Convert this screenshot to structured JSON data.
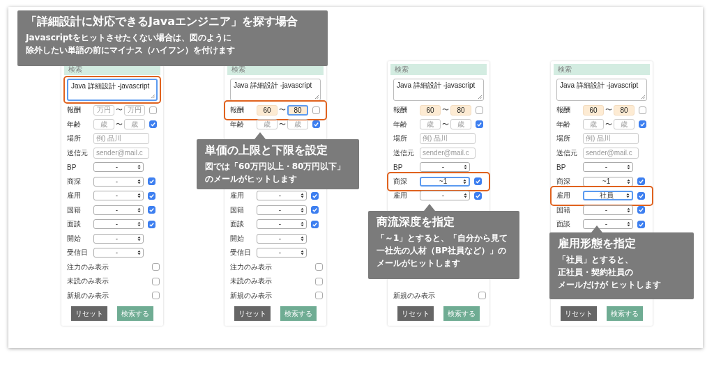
{
  "panels": [
    {
      "header": "検索",
      "query": {
        "value": "Java 詳細設計 -javascript",
        "focused": true,
        "highlighted": true
      },
      "rows": [
        {
          "kind": "range",
          "label": "報酬",
          "min": {
            "placeholder": "万円",
            "focused": false
          },
          "separator": "〜",
          "max": {
            "placeholder": "万円",
            "focused": false
          },
          "checked": false
        },
        {
          "kind": "range",
          "label": "年齢",
          "min": {
            "placeholder": "歳",
            "focused": false
          },
          "separator": "〜",
          "max": {
            "placeholder": "歳",
            "focused": false
          },
          "checked": true
        },
        {
          "kind": "text",
          "label": "場所",
          "placeholder": "例) 品川"
        },
        {
          "kind": "text",
          "label": "送信元",
          "placeholder": "sender@mail.c"
        },
        {
          "kind": "select",
          "label": "BP",
          "value": "-",
          "focused": false
        },
        {
          "kind": "select",
          "label": "商深",
          "value": "-",
          "focused": false,
          "checked": true
        },
        {
          "kind": "select",
          "label": "雇用",
          "value": "-",
          "focused": false,
          "checked": true
        },
        {
          "kind": "select",
          "label": "国籍",
          "value": "-",
          "focused": false,
          "checked": true
        },
        {
          "kind": "select",
          "label": "面談",
          "value": "-",
          "focused": false,
          "checked": true
        },
        {
          "kind": "select",
          "label": "開始",
          "value": "-",
          "focused": false
        },
        {
          "kind": "select",
          "label": "受信日",
          "value": "-",
          "focused": false
        },
        {
          "kind": "toggle",
          "label": "注力のみ表示",
          "checked": false
        },
        {
          "kind": "toggle",
          "label": "未読のみ表示",
          "checked": false
        },
        {
          "kind": "toggle",
          "label": "新規のみ表示",
          "checked": false
        }
      ],
      "buttons": [
        {
          "kind": "reset",
          "label": "リセット"
        },
        {
          "kind": "submit",
          "label": "検索する"
        }
      ]
    },
    {
      "header": "検索",
      "query": {
        "value": "Java 詳細設計 -javascript",
        "focused": false
      },
      "rows": [
        {
          "kind": "range",
          "label": "報酬",
          "min": {
            "value": "60",
            "focused": false
          },
          "separator": "〜",
          "max": {
            "value": "80",
            "focused": true
          },
          "checked": false,
          "highlighted": true
        },
        {
          "kind": "range",
          "label": "年齢",
          "min": {
            "placeholder": "歳",
            "focused": false
          },
          "separator": "〜",
          "max": {
            "placeholder": "歳",
            "focused": false
          },
          "checked": true
        },
        {
          "kind": "covered"
        },
        {
          "kind": "covered"
        },
        {
          "kind": "covered"
        },
        {
          "kind": "covered"
        },
        {
          "kind": "select",
          "label": "雇用",
          "value": "-",
          "focused": false,
          "checked": true
        },
        {
          "kind": "select",
          "label": "国籍",
          "value": "-",
          "focused": false,
          "checked": true
        },
        {
          "kind": "select",
          "label": "面談",
          "value": "-",
          "focused": false,
          "checked": true
        },
        {
          "kind": "select",
          "label": "開始",
          "value": "-",
          "focused": false
        },
        {
          "kind": "select",
          "label": "受信日",
          "value": "-",
          "focused": false
        },
        {
          "kind": "toggle",
          "label": "注力のみ表示",
          "checked": false
        },
        {
          "kind": "toggle",
          "label": "未読のみ表示",
          "checked": false
        },
        {
          "kind": "toggle",
          "label": "新規のみ表示",
          "checked": false
        }
      ],
      "buttons": [
        {
          "kind": "reset",
          "label": "リセット"
        },
        {
          "kind": "submit",
          "label": "検索する"
        }
      ]
    },
    {
      "header": "検索",
      "query": {
        "value": "Java 詳細設計 -javascript",
        "focused": false
      },
      "rows": [
        {
          "kind": "range",
          "label": "報酬",
          "min": {
            "value": "60",
            "focused": false
          },
          "separator": "〜",
          "max": {
            "value": "80",
            "focused": false
          },
          "checked": false
        },
        {
          "kind": "range",
          "label": "年齢",
          "min": {
            "placeholder": "歳",
            "focused": false
          },
          "separator": "〜",
          "max": {
            "placeholder": "歳",
            "focused": false
          },
          "checked": true
        },
        {
          "kind": "text",
          "label": "場所",
          "placeholder": "例) 品川"
        },
        {
          "kind": "text",
          "label": "送信元",
          "placeholder": "sender@mail.c"
        },
        {
          "kind": "select",
          "label": "BP",
          "value": "-",
          "focused": false
        },
        {
          "kind": "select",
          "label": "商深",
          "value": "~1",
          "focused": true,
          "highlighted": true,
          "checked": true
        },
        {
          "kind": "select",
          "label": "雇用",
          "value": "-",
          "focused": false,
          "checked": true
        },
        {
          "kind": "covered"
        },
        {
          "kind": "covered"
        },
        {
          "kind": "covered"
        },
        {
          "kind": "covered"
        },
        {
          "kind": "covered"
        },
        {
          "kind": "covered"
        },
        {
          "kind": "toggle",
          "label": "新規のみ表示",
          "checked": false
        }
      ],
      "buttons": [
        {
          "kind": "reset",
          "label": "リセット"
        },
        {
          "kind": "submit",
          "label": "検索する"
        }
      ]
    },
    {
      "header": "検索",
      "query": {
        "value": "Java 詳細設計 -javascript",
        "focused": false
      },
      "rows": [
        {
          "kind": "range",
          "label": "報酬",
          "min": {
            "value": "60",
            "focused": false
          },
          "separator": "〜",
          "max": {
            "value": "80",
            "focused": false
          },
          "checked": false
        },
        {
          "kind": "range",
          "label": "年齢",
          "min": {
            "placeholder": "歳",
            "focused": false
          },
          "separator": "〜",
          "max": {
            "placeholder": "歳",
            "focused": false
          },
          "checked": true
        },
        {
          "kind": "text",
          "label": "場所",
          "placeholder": "例) 品川"
        },
        {
          "kind": "text",
          "label": "送信元",
          "placeholder": "sender@mail.c"
        },
        {
          "kind": "select",
          "label": "BP",
          "value": "-",
          "focused": false
        },
        {
          "kind": "select",
          "label": "商深",
          "value": "~1",
          "focused": false,
          "checked": true
        },
        {
          "kind": "select",
          "label": "雇用",
          "value": "社員",
          "focused": true,
          "highlighted": true,
          "checked": true
        },
        {
          "kind": "select",
          "label": "国籍",
          "value": "-",
          "focused": false,
          "checked": true
        },
        {
          "kind": "select",
          "label": "面談",
          "value": "-",
          "focused": false,
          "checked": true
        },
        {
          "kind": "covered"
        },
        {
          "kind": "covered"
        },
        {
          "kind": "covered"
        },
        {
          "kind": "covered"
        },
        {
          "kind": "covered"
        }
      ],
      "buttons": [
        {
          "kind": "reset",
          "label": "リセット"
        },
        {
          "kind": "submit",
          "label": "検索する"
        }
      ]
    }
  ],
  "callouts": [
    {
      "title": "「詳細設計に対応できるJavaエンジニア」を探す場合",
      "lines": [
        "Javascriptをヒットさせたくない場合は、図のように",
        "除外したい単語の前にマイナス（ハイフン）を付けます"
      ],
      "pointer": false
    },
    {
      "title": "単価の上限と下限を設定",
      "lines": [
        "図では「60万円以上・80万円以下」",
        "のメールがヒットします"
      ],
      "pointer": true
    },
    {
      "title": "商流深度を指定",
      "lines": [
        "「～1」とすると、「自分から見て",
        "一社先の人材（BP社員など）」の",
        "メールがヒットします"
      ],
      "pointer": true
    },
    {
      "title": "雇用形態を指定",
      "lines": [
        "「社員」とすると、",
        "正社員・契約社員の",
        "メールだけが ヒットします"
      ],
      "pointer": true
    }
  ]
}
